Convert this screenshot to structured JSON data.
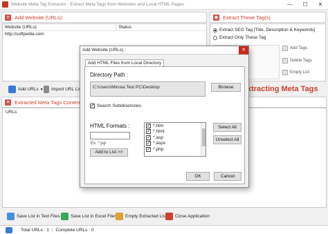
{
  "window": {
    "title": "Website Meta Tag Extractor - Extract Meta Tags from Websites and Local HTML Pages",
    "minimize": "—",
    "maximize": "☐",
    "close": "✕"
  },
  "add_website": {
    "header": "Add Website (URLs):",
    "columns": [
      "Website (URLs)",
      "Status"
    ],
    "rows": [
      {
        "url": "http://softpedia.com",
        "status": ""
      }
    ]
  },
  "extract_tags": {
    "header": "Extract These Tag(s)",
    "options": [
      {
        "label": "Extract SEO Tag [Title, Description & Keywords]",
        "selected": true
      },
      {
        "label": "Extract Only These Tag",
        "selected": false
      }
    ],
    "buttons": [
      "Add Tags",
      "Delete Tags",
      "Empty List"
    ]
  },
  "toolbar": {
    "add_urls": "Add URLs",
    "import_url": "Import URL Lis"
  },
  "extracting_banner": "xtracting Meta Tags",
  "extracted": {
    "header": "Extracted Meta Tags Content Li",
    "column": "URLs"
  },
  "bottom_toolbar": {
    "save_text": "Save List in Text Files",
    "save_excel": "Save List in Excel Files",
    "empty_list": "Empty Extracted List",
    "close_app": "Close Application"
  },
  "status": {
    "total_urls": "Total URLs : 1",
    "complete_urls": "Complete URLs : 0"
  },
  "dialog": {
    "title": "Add Website (URLs) :",
    "close": "✕",
    "tab": "Add HTML Files from Local Directory",
    "directory_label": "Directory Path :",
    "directory_value": "C:\\Users\\Mircea Test PC\\Desktop",
    "browse": "Browse",
    "search_sub": "Search Subdirectories",
    "formats_label": "HTML Formats :",
    "format_input": "",
    "format_hint": "Ex. *.jsp",
    "add_to_list": "Add to List >>",
    "formats": [
      "*.htm",
      "*.html",
      "*.asp",
      "*.aspx",
      "*.php"
    ],
    "select_all": "Select All",
    "unselect_all": "Unselect All",
    "ok": "OK",
    "cancel": "Cancel"
  },
  "colors": {
    "accent": "#d04030",
    "close_red": "#c42b1c"
  }
}
